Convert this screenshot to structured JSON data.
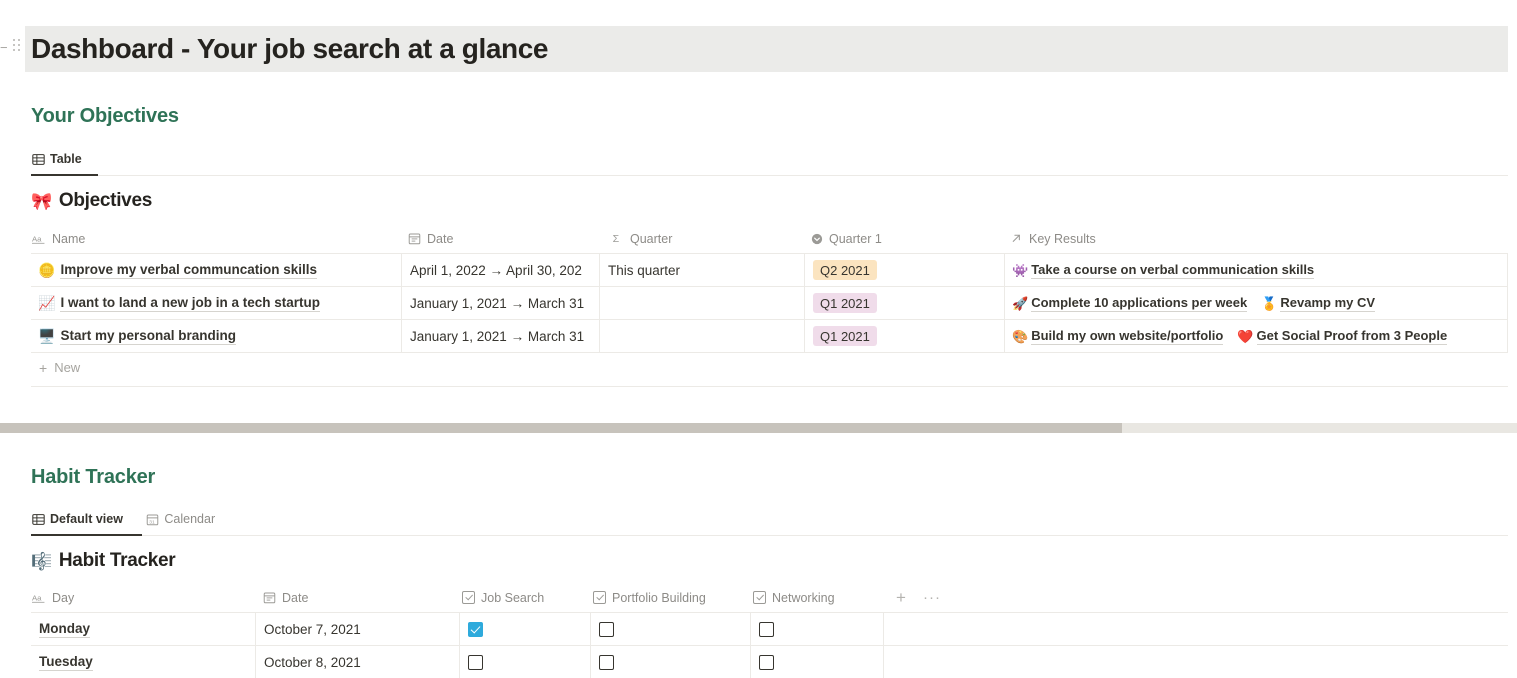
{
  "page": {
    "title": "Dashboard - Your job search at a glance",
    "collapse_icon": "collapse-arrow",
    "drag_icon": "drag-handle"
  },
  "colors": {
    "heading_green": "#2f7357",
    "title_band": "#ebebe9",
    "tag_orange_bg": "#fbe4c0",
    "tag_pink_bg": "#f0dcea",
    "checkbox_checked": "#2eaadc",
    "border": "#eceae6",
    "scroll_thumb": "#c7c3bc",
    "scroll_track": "#e9e7e2"
  },
  "objectives_section": {
    "heading": "Your Objectives",
    "tabs": [
      {
        "label": "Table",
        "icon": "table-icon",
        "active": true
      }
    ],
    "db_title": "Objectives",
    "db_emoji": "🎀",
    "columns": [
      {
        "label": "Name",
        "icon": "title-text-icon"
      },
      {
        "label": "Date",
        "icon": "calendar-icon"
      },
      {
        "label": "Quarter",
        "icon": "formula-sigma-icon"
      },
      {
        "label": "Quarter 1",
        "icon": "select-circle-icon"
      },
      {
        "label": "Key Results",
        "icon": "relation-arrow-icon"
      }
    ],
    "rows": [
      {
        "emoji": "🪙",
        "name": "Improve my verbal communcation skills",
        "date": "April 1, 2022 → April 30, 202",
        "quarter": "This quarter",
        "quarter1": "Q2 2021",
        "quarter1_color": "orange",
        "key_results": [
          {
            "emoji": "👾",
            "text": "Take a course on verbal communication skills"
          }
        ]
      },
      {
        "emoji": "📈",
        "name": "I want to land a new job in a tech startup",
        "date": "January 1, 2021 → March 31",
        "quarter": "",
        "quarter1": "Q1 2021",
        "quarter1_color": "pink",
        "key_results": [
          {
            "emoji": "🚀",
            "text": "Complete 10 applications per week"
          },
          {
            "emoji": "🏅",
            "text": "Revamp my CV"
          }
        ]
      },
      {
        "emoji": "🖥️",
        "name": "Start my personal branding",
        "date": "January 1, 2021 → March 31",
        "quarter": "",
        "quarter1": "Q1 2021",
        "quarter1_color": "pink",
        "key_results": [
          {
            "emoji": "🎨",
            "text": "Build my own website/portfolio"
          },
          {
            "emoji": "❤️",
            "text": "Get Social Proof from 3 People"
          }
        ]
      }
    ],
    "new_row_label": "New"
  },
  "habit_section": {
    "heading": "Habit Tracker",
    "tabs": [
      {
        "label": "Default view",
        "icon": "table-icon",
        "active": true
      },
      {
        "label": "Calendar",
        "icon": "calendar-view-icon",
        "active": false
      }
    ],
    "db_title": "Habit Tracker",
    "db_emoji": "🎼",
    "columns": [
      {
        "label": "Day",
        "icon": "title-text-icon"
      },
      {
        "label": "Date",
        "icon": "calendar-icon"
      },
      {
        "label": "Job Search",
        "icon": "checkbox-icon"
      },
      {
        "label": "Portfolio Building",
        "icon": "checkbox-icon"
      },
      {
        "label": "Networking",
        "icon": "checkbox-icon"
      }
    ],
    "add_column_label": "+",
    "more_options_label": "···",
    "rows": [
      {
        "day": "Monday",
        "date": "October 7, 2021",
        "job_search": true,
        "portfolio_building": false,
        "networking": false
      },
      {
        "day": "Tuesday",
        "date": "October 8, 2021",
        "job_search": false,
        "portfolio_building": false,
        "networking": false
      }
    ]
  }
}
